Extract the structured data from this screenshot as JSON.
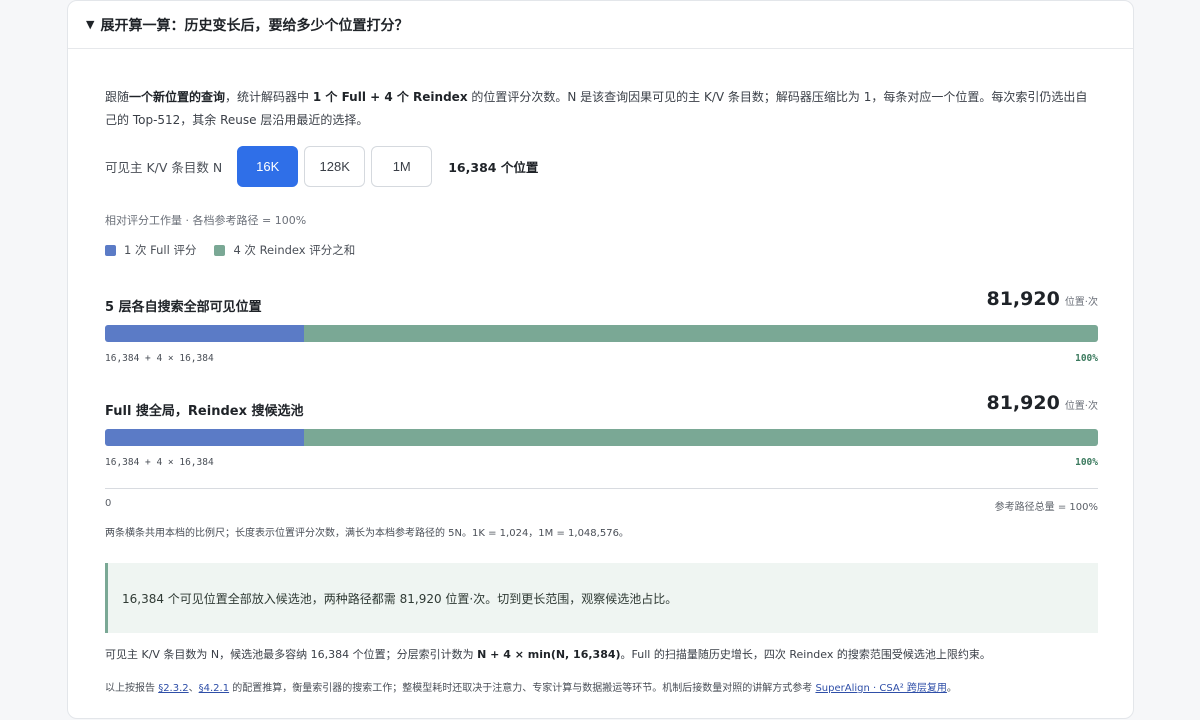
{
  "summary": {
    "marker": "▼",
    "title": "展开算一算：历史变长后，要给多少个位置打分？"
  },
  "intro": {
    "p1": "跟随",
    "p2": "一个新位置的查询",
    "p3": "，统计解码器中 ",
    "p4": "1 个 Full + 4 个 Reindex",
    "p5": " 的位置评分次数。N 是该查询因果可见的主 K/V 条目数；解码器压缩比为 1，每条对应一个位置。每次索引仍选出自己的 Top-512，其余 Reuse 层沿用最近的选择。"
  },
  "controls": {
    "label": "可见主 K/V 条目数 N",
    "options": [
      "16K",
      "128K",
      "1M"
    ],
    "selected": "16K",
    "positions_text": "16,384 个位置"
  },
  "scale_note": "相对评分工作量 · 各档参考路径 = 100%",
  "legend": {
    "full": {
      "label": "1 次 Full 评分",
      "color": "#5b7bc6"
    },
    "reindex": {
      "label": "4 次 Reindex 评分之和",
      "color": "#7aa895"
    }
  },
  "rows": [
    {
      "title": "5 层各自搜索全部可见位置",
      "value": "81,920",
      "unit": "位置·次",
      "full_fraction": 0.2,
      "reindex_fraction": 0.8,
      "formula": "16,384 + 4 × 16,384",
      "percent": "100%"
    },
    {
      "title": "Full 搜全局，Reindex 搜候选池",
      "value": "81,920",
      "unit": "位置·次",
      "full_fraction": 0.2,
      "reindex_fraction": 0.8,
      "formula": "16,384 + 4 × 16,384",
      "percent": "100%"
    }
  ],
  "axis": {
    "zero": "0",
    "ref": "参考路径总量 = 100%"
  },
  "axis_note": "两条横条共用本档的比例尺；长度表示位置评分次数，满长为本档参考路径的 5N。1K = 1,024，1M = 1,048,576。",
  "callout": "16,384 个可见位置全部放入候选池，两种路径都需 81,920 位置·次。切到更长范围，观察候选池占比。",
  "explain": {
    "a": "可见主 K/V 条目数为 N，候选池最多容纳 16,384 个位置；分层索引计数为 ",
    "b": "N + 4 × min(N, 16,384)",
    "c": "。Full 的扫描量随历史增长，四次 Reindex 的搜索范围受候选池上限约束。"
  },
  "footnote": {
    "a": "以上按报告 ",
    "link1": "§2.3.2",
    "sep": "、",
    "link2": "§4.2.1",
    "b": " 的配置推算，衡量索引器的搜索工作；整模型耗时还取决于注意力、专家计算与数据搬运等环节。机制后接数量对照的讲解方式参考 ",
    "link3": "SuperAlign · CSA² 跨层复用",
    "c": "。"
  }
}
